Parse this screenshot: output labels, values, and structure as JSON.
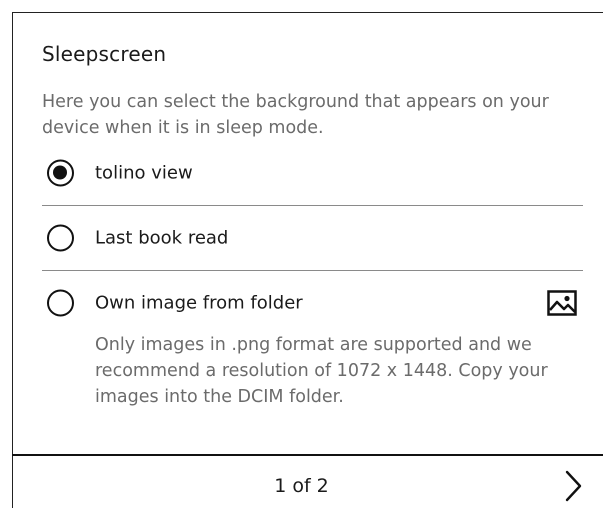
{
  "settings": {
    "title": "Sleepscreen",
    "description": "Here you can select the background that appears on your device when it is in sleep mode.",
    "options": [
      {
        "label": "tolino view",
        "selected": true
      },
      {
        "label": "Last book read",
        "selected": false
      },
      {
        "label": "Own image from folder",
        "selected": false,
        "icon": "image-icon"
      }
    ],
    "image_note": "Only images in .png format are supported and we recommend a resolution of 1072 x 1448. Copy your images into the DCIM folder."
  },
  "pagination": {
    "label": "1 of 2",
    "next_icon": "chevron-right-icon"
  }
}
